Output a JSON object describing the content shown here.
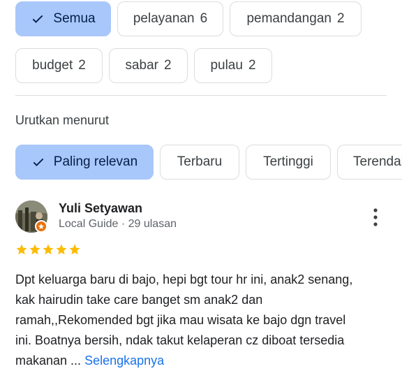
{
  "filter_chips": [
    {
      "label": "Semua",
      "count": "",
      "selected": true
    },
    {
      "label": "pelayanan",
      "count": "6",
      "selected": false
    },
    {
      "label": "pemandangan",
      "count": "2",
      "selected": false
    },
    {
      "label": "budget",
      "count": "2",
      "selected": false
    },
    {
      "label": "sabar",
      "count": "2",
      "selected": false
    },
    {
      "label": "pulau",
      "count": "2",
      "selected": false
    }
  ],
  "sort": {
    "label": "Urutkan menurut",
    "options": [
      {
        "label": "Paling relevan",
        "selected": true
      },
      {
        "label": "Terbaru",
        "selected": false
      },
      {
        "label": "Tertinggi",
        "selected": false
      },
      {
        "label": "Terendah",
        "selected": false
      }
    ]
  },
  "review": {
    "author": "Yuli Setyawan",
    "meta": "Local Guide · 29 ulasan",
    "rating": 5,
    "text_lines": [
      "Dpt keluarga baru di bajo, hepi bgt tour hr ini, anak2 senang,",
      "kak hairudin take care banget sm anak2 dan",
      "ramah,,Rekomended bgt jika mau wisata ke bajo dgn travel",
      "ini. Boatnya bersih, ndak takut kelaperan cz diboat tersedia",
      "makanan ..."
    ],
    "see_more": "Selengkapnya"
  },
  "colors": {
    "selected_chip_bg": "#a8c7fa",
    "star": "#fbbc04",
    "link": "#1a73e8",
    "local_guide_badge": "#e8710a"
  },
  "icons": {
    "check": "check-icon",
    "more": "more-vert-icon",
    "star": "star-icon",
    "badge": "local-guide-badge-icon"
  }
}
